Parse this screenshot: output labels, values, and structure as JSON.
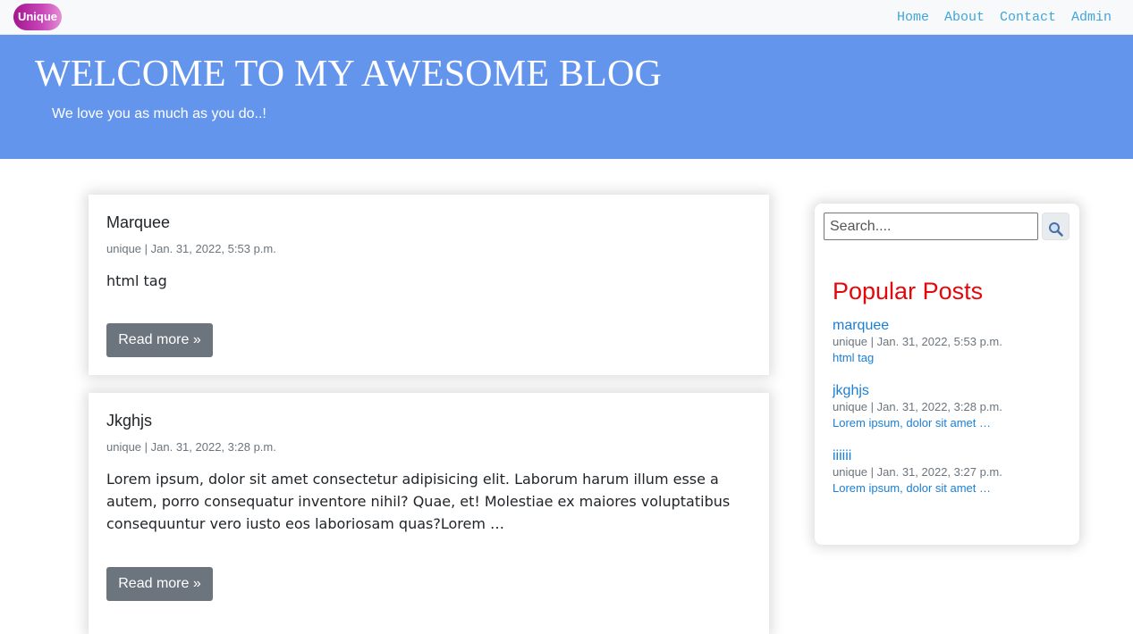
{
  "navbar": {
    "brand": "Unique",
    "links": [
      "Home",
      "About",
      "Contact",
      "Admin"
    ]
  },
  "hero": {
    "title": "WELCOME TO MY AWESOME BLOG",
    "subtitle": "We love you as much as you do..!"
  },
  "posts": [
    {
      "title": "Marquee",
      "meta": "unique | Jan. 31, 2022, 5:53 p.m.",
      "body": "html tag",
      "button": "Read more »"
    },
    {
      "title": "Jkghjs",
      "meta": "unique | Jan. 31, 2022, 3:28 p.m.",
      "body": "Lorem ipsum, dolor sit amet consectetur adipisicing elit. Laborum harum illum esse a autem, porro consequatur inventore nihil? Quae, et! Molestiae ex maiores voluptatibus consequuntur vero iusto eos laboriosam quas?Lorem …",
      "button": "Read more »"
    }
  ],
  "sidebar": {
    "search_placeholder": "Search....",
    "search_icon": "search-icon",
    "heading": "Popular Posts",
    "items": [
      {
        "title": "marquee",
        "meta": "unique | Jan. 31, 2022, 5:53 p.m.",
        "excerpt": "html tag"
      },
      {
        "title": "jkghjs",
        "meta": "unique | Jan. 31, 2022, 3:28 p.m.",
        "excerpt": "Lorem ipsum, dolor sit amet …"
      },
      {
        "title": "iiiiii",
        "meta": "unique | Jan. 31, 2022, 3:27 p.m.",
        "excerpt": "Lorem ipsum, dolor sit amet …"
      }
    ]
  },
  "colors": {
    "hero_bg": "#6495ed",
    "nav_link": "#3ea6d8",
    "heading_red": "#e4080a",
    "link_blue": "#1a7fd4",
    "button_gray": "#6c757d"
  }
}
